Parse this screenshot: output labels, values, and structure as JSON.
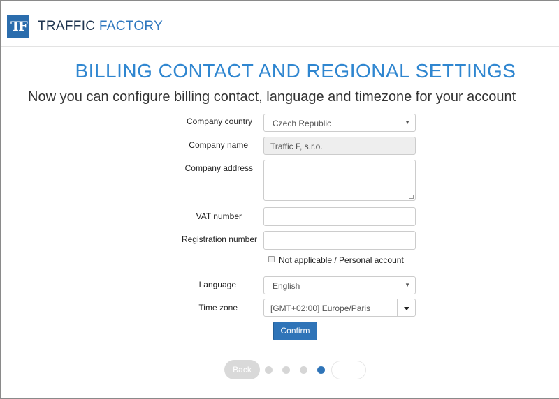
{
  "header": {
    "logo_text": "TF",
    "brand_part1": "TRAFFIC",
    "brand_part2": "FACTORY",
    "brand_color": "#2f78bf"
  },
  "page": {
    "title": "BILLING CONTACT AND REGIONAL SETTINGS",
    "subtitle": "Now you can configure billing contact, language and timezone for your account"
  },
  "form": {
    "company_country": {
      "label": "Company country",
      "value": "Czech Republic"
    },
    "company_name": {
      "label": "Company name",
      "value": "Traffic F, s.r.o."
    },
    "company_address": {
      "label": "Company address",
      "value": ""
    },
    "vat_number": {
      "label": "VAT number",
      "value": ""
    },
    "registration_number": {
      "label": "Registration number",
      "value": ""
    },
    "not_applicable": {
      "label": "Not applicable / Personal account",
      "checked": false
    },
    "language": {
      "label": "Language",
      "value": "English"
    },
    "time_zone": {
      "label": "Time zone",
      "value": "[GMT+02:00] Europe/Paris"
    },
    "confirm_label": "Confirm"
  },
  "wizard": {
    "back_label": "Back",
    "total_steps": 4,
    "current_step": 4,
    "accent_color": "#2f74b8"
  }
}
